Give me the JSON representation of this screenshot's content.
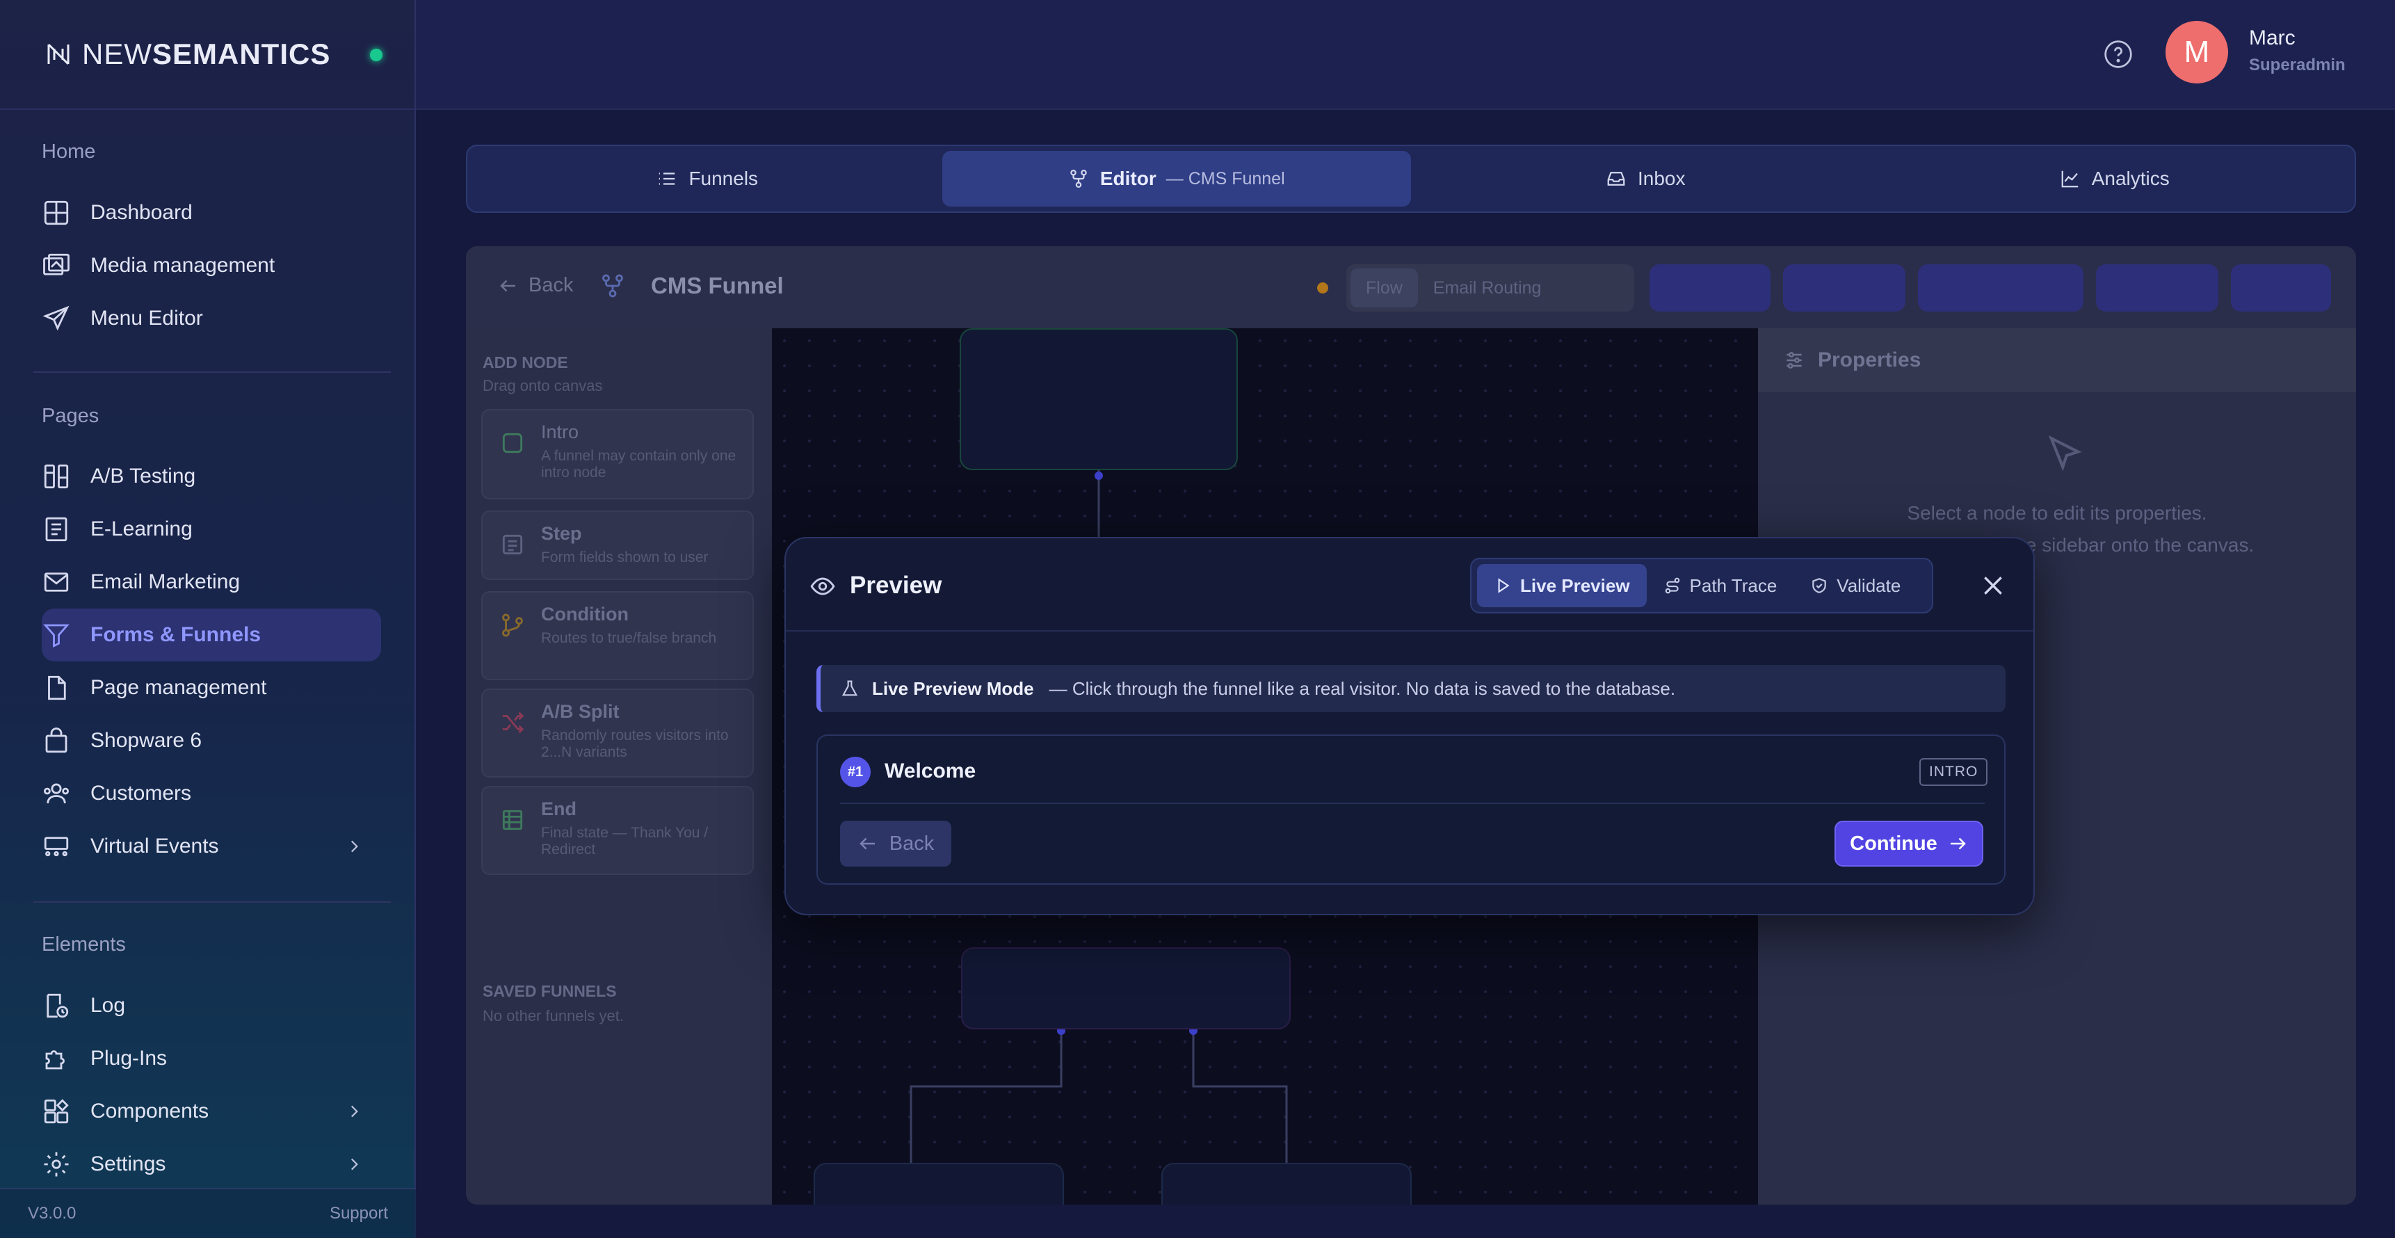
{
  "brand": {
    "name_light": "NEW",
    "name_bold": "SEMANTICS"
  },
  "sidebar": {
    "sections": {
      "home": "Home",
      "pages": "Pages",
      "elements": "Elements"
    },
    "home_items": [
      {
        "label": "Dashboard",
        "icon": "grid-icon"
      },
      {
        "label": "Media management",
        "icon": "images-icon"
      },
      {
        "label": "Menu Editor",
        "icon": "send-icon"
      }
    ],
    "page_items": [
      {
        "label": "A/B Testing",
        "icon": "flask-icon"
      },
      {
        "label": "E-Learning",
        "icon": "book-icon"
      },
      {
        "label": "Email Marketing",
        "icon": "mail-icon"
      },
      {
        "label": "Forms & Funnels",
        "icon": "filter-icon",
        "active": true
      },
      {
        "label": "Page management",
        "icon": "file-icon"
      },
      {
        "label": "Shopware 6",
        "icon": "bag-icon"
      },
      {
        "label": "Customers",
        "icon": "users-icon"
      },
      {
        "label": "Virtual Events",
        "icon": "events-icon",
        "has_children": true
      }
    ],
    "element_items": [
      {
        "label": "Log",
        "icon": "log-icon"
      },
      {
        "label": "Plug-Ins",
        "icon": "puzzle-icon"
      },
      {
        "label": "Components",
        "icon": "components-icon",
        "has_children": true
      },
      {
        "label": "Settings",
        "icon": "gear-icon",
        "has_children": true
      }
    ],
    "footer": {
      "version": "V3.0.0",
      "support": "Support"
    }
  },
  "user": {
    "initial": "M",
    "name": "Marc",
    "role": "Superadmin"
  },
  "tabs": [
    {
      "label": "Funnels",
      "icon": "list-icon"
    },
    {
      "label": "Editor",
      "sub": "— CMS Funnel",
      "icon": "flow-icon",
      "active": true
    },
    {
      "label": "Inbox",
      "icon": "inbox-icon"
    },
    {
      "label": "Analytics",
      "icon": "chart-icon"
    }
  ],
  "editor": {
    "back": "Back",
    "title": "CMS Funnel",
    "segments": {
      "flow": "Flow",
      "email_routing": "Email Routing"
    },
    "add_node": {
      "title": "ADD NODE",
      "subtitle": "Drag onto canvas",
      "nodes": [
        {
          "title": "Intro",
          "desc": "A funnel may contain only one intro node"
        },
        {
          "title": "Step",
          "desc": "Form fields shown to user"
        },
        {
          "title": "Condition",
          "desc": "Routes to true/false branch"
        },
        {
          "title": "A/B Split",
          "desc": "Randomly routes visitors into 2...N variants"
        },
        {
          "title": "End",
          "desc": "Final state — Thank You / Redirect"
        }
      ],
      "saved_title": "SAVED FUNNELS",
      "saved_sub": "No other funnels yet."
    },
    "properties": {
      "title": "Properties",
      "line1": "Select a node to edit its properties.",
      "line2": "…om the sidebar onto the canvas."
    }
  },
  "modal": {
    "title": "Preview",
    "modes": [
      {
        "label": "Live Preview",
        "icon": "play-icon",
        "active": true
      },
      {
        "label": "Path Trace",
        "icon": "route-icon"
      },
      {
        "label": "Validate",
        "icon": "shield-icon"
      }
    ],
    "info": {
      "bold": "Live Preview Mode",
      "text": "— Click through the funnel like a real visitor. No data is saved to the database."
    },
    "step": {
      "number": "#1",
      "title": "Welcome",
      "badge": "INTRO",
      "back": "Back",
      "continue": "Continue"
    }
  },
  "colors": {
    "accent": "#5144e2",
    "active_nav": "#8f97ff",
    "status_online": "#19c88f",
    "avatar": "#ee6e6e"
  }
}
